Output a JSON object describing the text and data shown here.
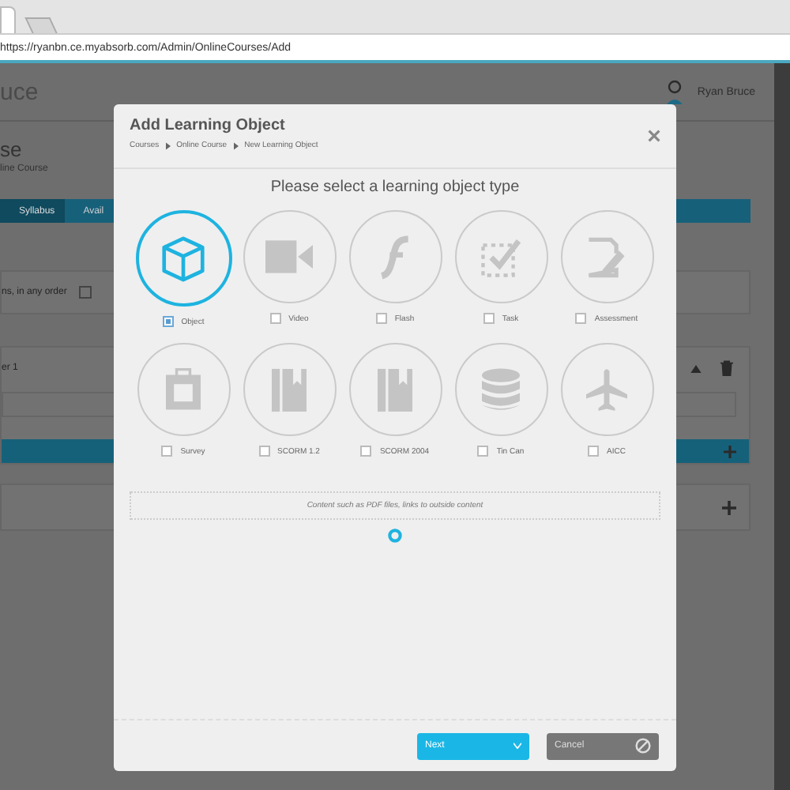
{
  "browser": {
    "url": "https://ryanbn.ce.myabsorb.com/Admin/OnlineCourses/Add"
  },
  "page": {
    "logo": "uce",
    "user": "Ryan Bruce",
    "heading": "se",
    "subheading": "line Course",
    "tabs": [
      {
        "label": "Syllabus",
        "selected": true
      },
      {
        "label": "Avail",
        "selected": false
      }
    ],
    "option": "ns, in any order",
    "option_checked": false,
    "section": "er 1"
  },
  "dialog": {
    "title": "Add Learning Object",
    "breadcrumb": [
      "Courses",
      "Online Course",
      "New Learning Object"
    ],
    "prompt": "Please select a learning object type",
    "types": [
      {
        "label": "Object",
        "kind": "object",
        "selected": true
      },
      {
        "label": "Video",
        "kind": "video",
        "selected": false
      },
      {
        "label": "Flash",
        "kind": "flash",
        "selected": false
      },
      {
        "label": "Task",
        "kind": "task",
        "selected": false
      },
      {
        "label": "Assessment",
        "kind": "assessment",
        "selected": false
      },
      {
        "label": "Survey",
        "kind": "survey",
        "selected": false
      },
      {
        "label": "SCORM 1.2",
        "kind": "scorm",
        "selected": false
      },
      {
        "label": "SCORM 2004",
        "kind": "scorm",
        "selected": false
      },
      {
        "label": "Tin Can",
        "kind": "tincan",
        "selected": false
      },
      {
        "label": "AICC",
        "kind": "aicc",
        "selected": false
      }
    ],
    "description": "Content such as PDF files, links to outside content",
    "buttons": [
      {
        "label": "Next",
        "kind": "primary"
      },
      {
        "label": "Cancel",
        "kind": "cancel"
      }
    ]
  }
}
